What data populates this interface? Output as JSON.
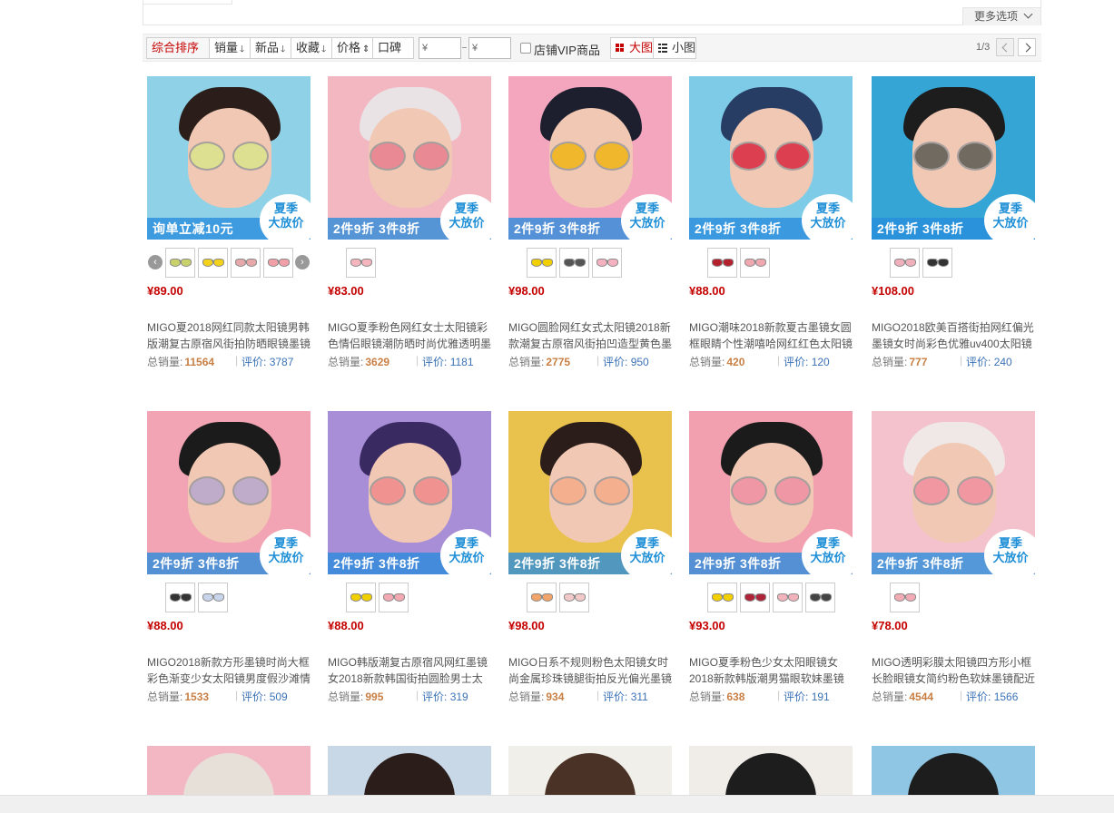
{
  "toolbar": {
    "more_options": "更多选项",
    "sort": {
      "composite": "综合排序",
      "sales": "销量",
      "new": "新品",
      "favorites": "收藏",
      "price": "价格",
      "reputation": "口碑"
    },
    "price_min_placeholder": "¥",
    "price_max_placeholder": "¥",
    "vip_label": "店铺VIP商品",
    "view_large": "大图",
    "view_small": "小图",
    "pager": "1/3"
  },
  "labels": {
    "sales": "总销量:",
    "reviews": "评价:"
  },
  "badge": {
    "line1": "夏季",
    "line2": "大放价"
  },
  "products": [
    {
      "price": "¥89.00",
      "title": "MIGO夏2018网红同款太阳镜男韩版潮复古原宿风街拍防晒眼镜墨镜",
      "sales": "11564",
      "reviews": "3787",
      "promo": "询单立减10元",
      "bg": "#8fd1e6",
      "lens": "#d9e58a",
      "hair": "#2a1d1a",
      "swatches": [
        "#c9d16a",
        "#f2d21a",
        "#e6a8a8",
        "#f2a0a8"
      ],
      "has_arrows": true
    },
    {
      "price": "¥83.00",
      "title": "MIGO夏季粉色网红女士太阳镜彩色情侣眼镜潮防晒时尚优雅透明墨镜",
      "sales": "3629",
      "reviews": "1181",
      "promo": "2件9折  3件8折",
      "bg": "#f3b7c1",
      "lens": "#e77f8e",
      "hair": "#e9e3e6",
      "swatches": [
        "#f4b5bd"
      ],
      "has_arrows": false
    },
    {
      "price": "¥98.00",
      "title": "MIGO圆脸网红女式太阳镜2018新款潮复古原宿风街拍凹造型黄色墨镜",
      "sales": "2775",
      "reviews": "950",
      "promo": "2件9折  3件8折",
      "bg": "#f4a6bf",
      "lens": "#f2b515",
      "hair": "#1e1f2e",
      "swatches": [
        "#f2d000",
        "#555555",
        "#f4b1bf"
      ],
      "has_arrows": false
    },
    {
      "price": "¥88.00",
      "title": "MIGO潮味2018新款夏古墨镜女圆框眼睛个性潮嘻哈网红红色太阳镜",
      "sales": "420",
      "reviews": "120",
      "promo": "2件9折  3件8折",
      "bg": "#7ecbe8",
      "lens": "#d9283e",
      "hair": "#283d63",
      "swatches": [
        "#b5202e",
        "#f0a8b0"
      ],
      "has_arrows": false
    },
    {
      "price": "¥108.00",
      "title": "MIGO2018欧美百搭街拍网红偏光墨镜女时尚彩色优雅uv400太阳镜",
      "sales": "777",
      "reviews": "240",
      "promo": "2件9折  3件8折",
      "bg": "#35a5d6",
      "lens": "#5a5a52",
      "hair": "#1d1d1d",
      "swatches": [
        "#efb0bb",
        "#333333"
      ],
      "has_arrows": false
    },
    {
      "price": "¥88.00",
      "title": "MIGO2018新款方形墨镜时尚大框彩色渐变少女太阳镜男度假沙滩情侣",
      "sales": "1533",
      "reviews": "509",
      "promo": "2件9折  3件8折",
      "bg": "#f2a4b4",
      "lens": "#b7a7cf",
      "hair": "#1b1b1b",
      "swatches": [
        "#333333",
        "#c8d4ea"
      ],
      "has_arrows": false
    },
    {
      "price": "¥88.00",
      "title": "MIGO韩版潮复古原宿风网红墨镜女2018新款韩国街拍圆脸男士太阳镜",
      "sales": "995",
      "reviews": "319",
      "promo": "2件9折  3件8折",
      "bg": "#a88ed6",
      "lens": "#f08a8a",
      "hair": "#3a2a62",
      "swatches": [
        "#f2d000",
        "#f3a8b2"
      ],
      "has_arrows": false
    },
    {
      "price": "¥98.00",
      "title": "MIGO日系不规则粉色太阳镜女时尚金属珍珠镜腿街拍反光偏光墨镜",
      "sales": "934",
      "reviews": "311",
      "promo": "2件9折  3件8折",
      "bg": "#e9c14d",
      "lens": "#f4ab88",
      "hair": "#2a1d1a",
      "swatches": [
        "#f2a56a",
        "#f2c8c8"
      ],
      "has_arrows": false
    },
    {
      "price": "¥93.00",
      "title": "MIGO夏季粉色少女太阳眼镜女2018新款韩版潮男猫眼软妹墨镜",
      "sales": "638",
      "reviews": "191",
      "promo": "2件9折  3件8折",
      "bg": "#f2a0b0",
      "lens": "#ef8fa2",
      "hair": "#1b1b1b",
      "swatches": [
        "#f2d000",
        "#b0243a",
        "#f2b2bc",
        "#444444"
      ],
      "has_arrows": false
    },
    {
      "price": "¥78.00",
      "title": "MIGO透明彩膜太阳镜四方形小框长脸眼镜女简约粉色软妹墨镜配近视",
      "sales": "4544",
      "reviews": "1566",
      "promo": "2件9折  3件8折",
      "bg": "#f3c2cc",
      "lens": "#f08f9f",
      "hair": "#efe8e6",
      "swatches": [
        "#f2aab4"
      ],
      "has_arrows": false
    }
  ],
  "partial_row": [
    {
      "bg": "#f3b6c3",
      "hair": "#e7e0d8"
    },
    {
      "bg": "#c9d8e6",
      "hair": "#2a1d1a"
    },
    {
      "bg": "#f1efe9",
      "hair": "#4a3326"
    },
    {
      "bg": "#f0ece8",
      "hair": "#1d1d1d"
    },
    {
      "bg": "#8ec6e4",
      "hair": "#1d1d1d"
    }
  ]
}
